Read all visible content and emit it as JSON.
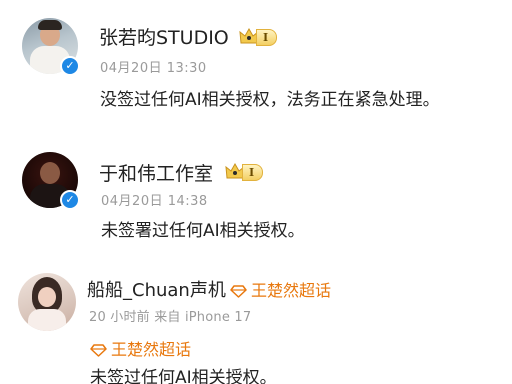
{
  "colors": {
    "verified": "#1e88e5",
    "crown_gold": "#f2c94c",
    "tag_orange": "#e8780e",
    "meta_gray": "#9a9a9a",
    "text_dark": "#222222"
  },
  "posts": [
    {
      "author": "张若昀STUDIO",
      "level": "I",
      "timestamp": "04月20日 13:30",
      "content": "没签过任何AI相关授权，法务正在紧急处理。"
    },
    {
      "author": "于和伟工作室",
      "level": "I",
      "timestamp": "04月20日 14:38",
      "content": "未签署过任何AI相关授权。"
    },
    {
      "author": "船船_Chuan声机",
      "tag": "王楚然超话",
      "meta": "20 小时前  来自 iPhone 17",
      "inline_tag": "王楚然超话",
      "content": "未签过任何AI相关授权。"
    }
  ]
}
